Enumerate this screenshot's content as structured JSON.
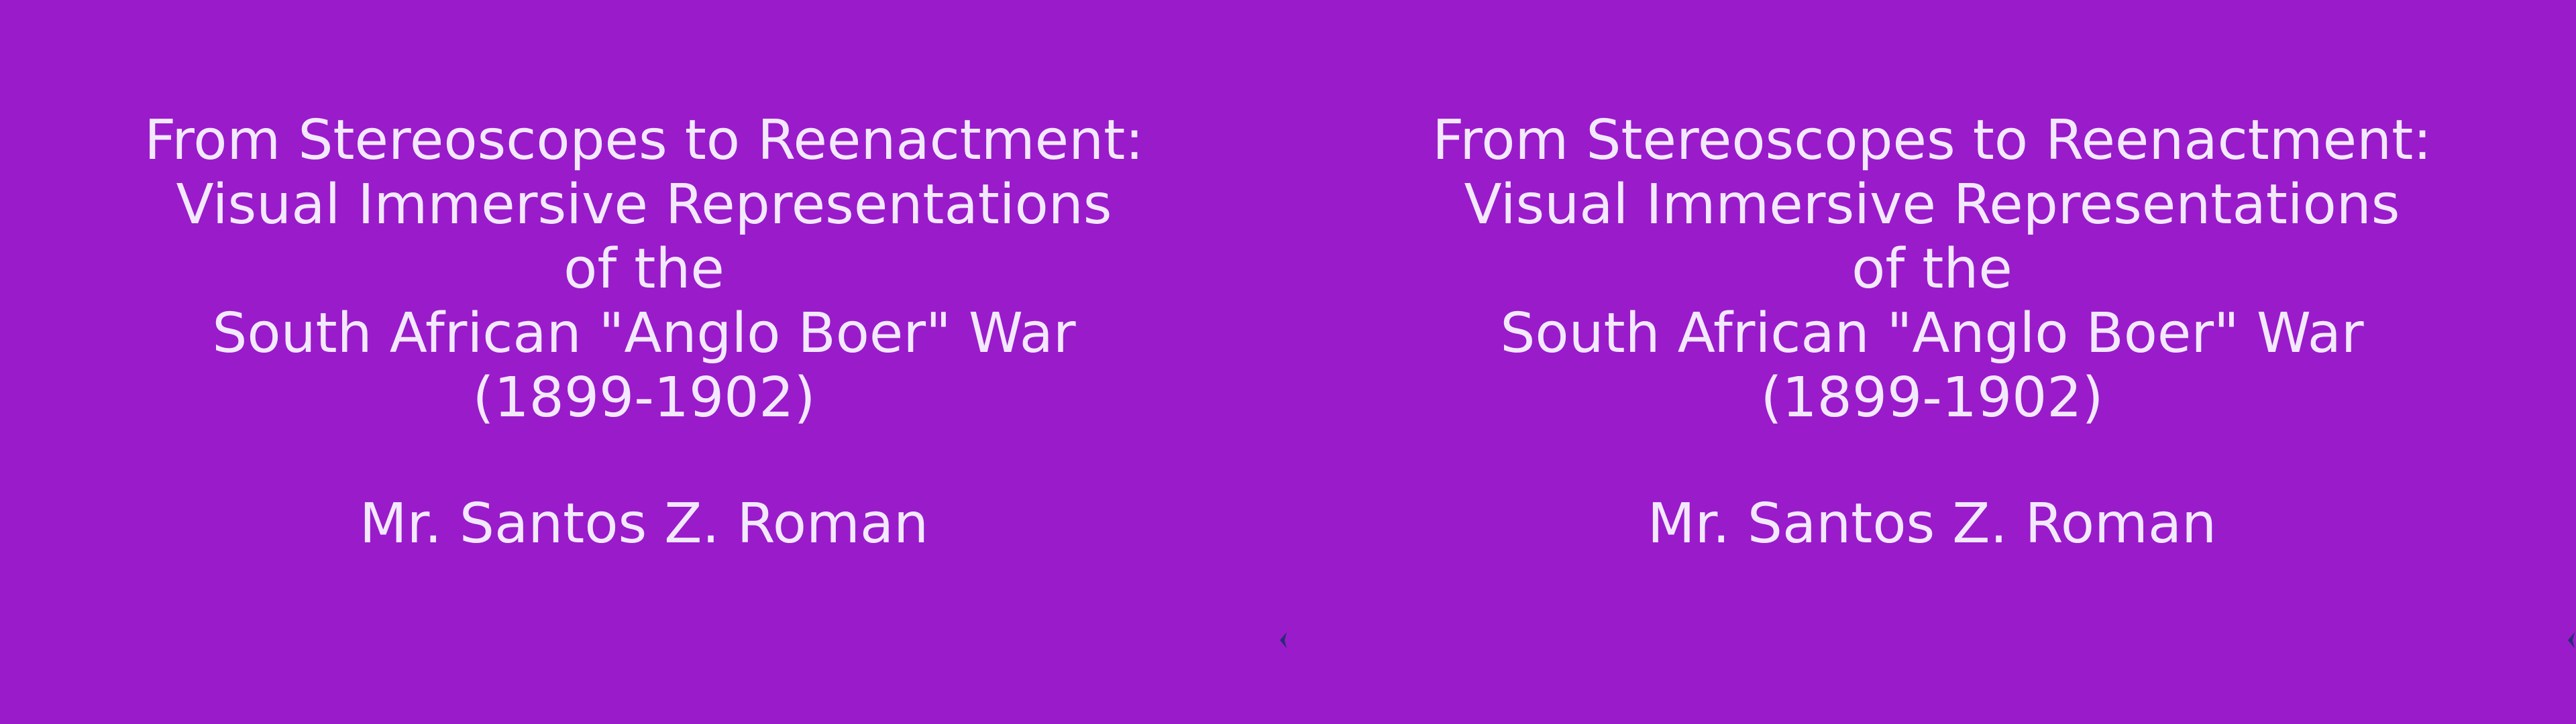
{
  "slide": {
    "title_lines": [
      "From Stereoscopes to Reenactment:",
      "Visual Immersive Representations",
      "of the",
      "South African \"Anglo Boer\" War",
      "(1899-1902)"
    ],
    "author": "Mr. Santos Z. Roman"
  },
  "colors": {
    "background": "#9a1bca",
    "text": "#f3e9ff",
    "arrow": "#2c2a7a"
  },
  "icons": {
    "navigation": "chevron-left-icon"
  }
}
